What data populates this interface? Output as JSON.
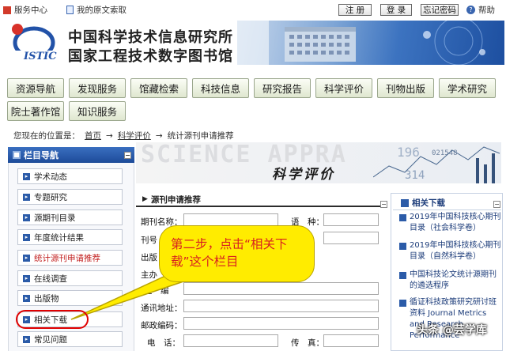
{
  "topbar": {
    "service_center": "服务中心",
    "my_subscription": "我的原文索取",
    "register": "注 册",
    "login": "登 录",
    "forgot_password": "忘记密码",
    "help": "帮助"
  },
  "header": {
    "logo_text": "ISTIC",
    "org_line1": "中国科学技术信息研究所",
    "org_line2": "国家工程技术数字图书馆"
  },
  "nav": {
    "row1": [
      "资源导航",
      "发现服务",
      "馆藏检索",
      "科技信息",
      "研究报告",
      "科学评价",
      "刊物出版",
      "学术研究"
    ],
    "row2": [
      "院士著作馆",
      "知识服务"
    ]
  },
  "breadcrumb": {
    "prefix": "您现在的位置是：",
    "home": "首页",
    "sep1": "→",
    "section": "科学评价",
    "sep2": "→",
    "current": "统计源刊申请推荐"
  },
  "sidebar": {
    "title": "栏目导航",
    "items": [
      {
        "label": "学术动态"
      },
      {
        "label": "专题研究"
      },
      {
        "label": "源期刊目录"
      },
      {
        "label": "年度统计结果"
      },
      {
        "label": "统计源刊申请推荐"
      },
      {
        "label": "在线调查"
      },
      {
        "label": "出版物"
      },
      {
        "label": "相关下载"
      },
      {
        "label": "常见问题"
      }
    ]
  },
  "banner": {
    "ghost_text": "SCIENCE APPRA",
    "title": "科学评价"
  },
  "form": {
    "title": "源刊申请推荐",
    "labels": {
      "journal_name": "期刊名称：",
      "language": "语　种：",
      "issn": "刊号",
      "publisher": "出版",
      "sponsor": "主办",
      "editor": "主　编",
      "address": "通讯地址：",
      "postcode": "邮政编码：",
      "phone": "电　话：",
      "fax": "传　真："
    }
  },
  "downloads": {
    "title": "相关下载",
    "items": [
      "2019年中国科技核心期刊目录（社会科学卷）",
      "2019年中国科技核心期刊目录（自然科学卷）",
      "中国科技论文统计源期刊的遴选程序",
      "循证科技政策研究研讨班资料 Journal Metrics and Research Performance"
    ]
  },
  "callout": {
    "text": "第二步，点击“相关下载”这个栏目"
  },
  "watermark": "头条 @芸学库",
  "colors": {
    "callout_bg": "#ffec00",
    "callout_text": "#d82020",
    "highlight_ring": "#e10000",
    "sidebar_header": "#1d4b99",
    "active_item": "#c32222"
  }
}
